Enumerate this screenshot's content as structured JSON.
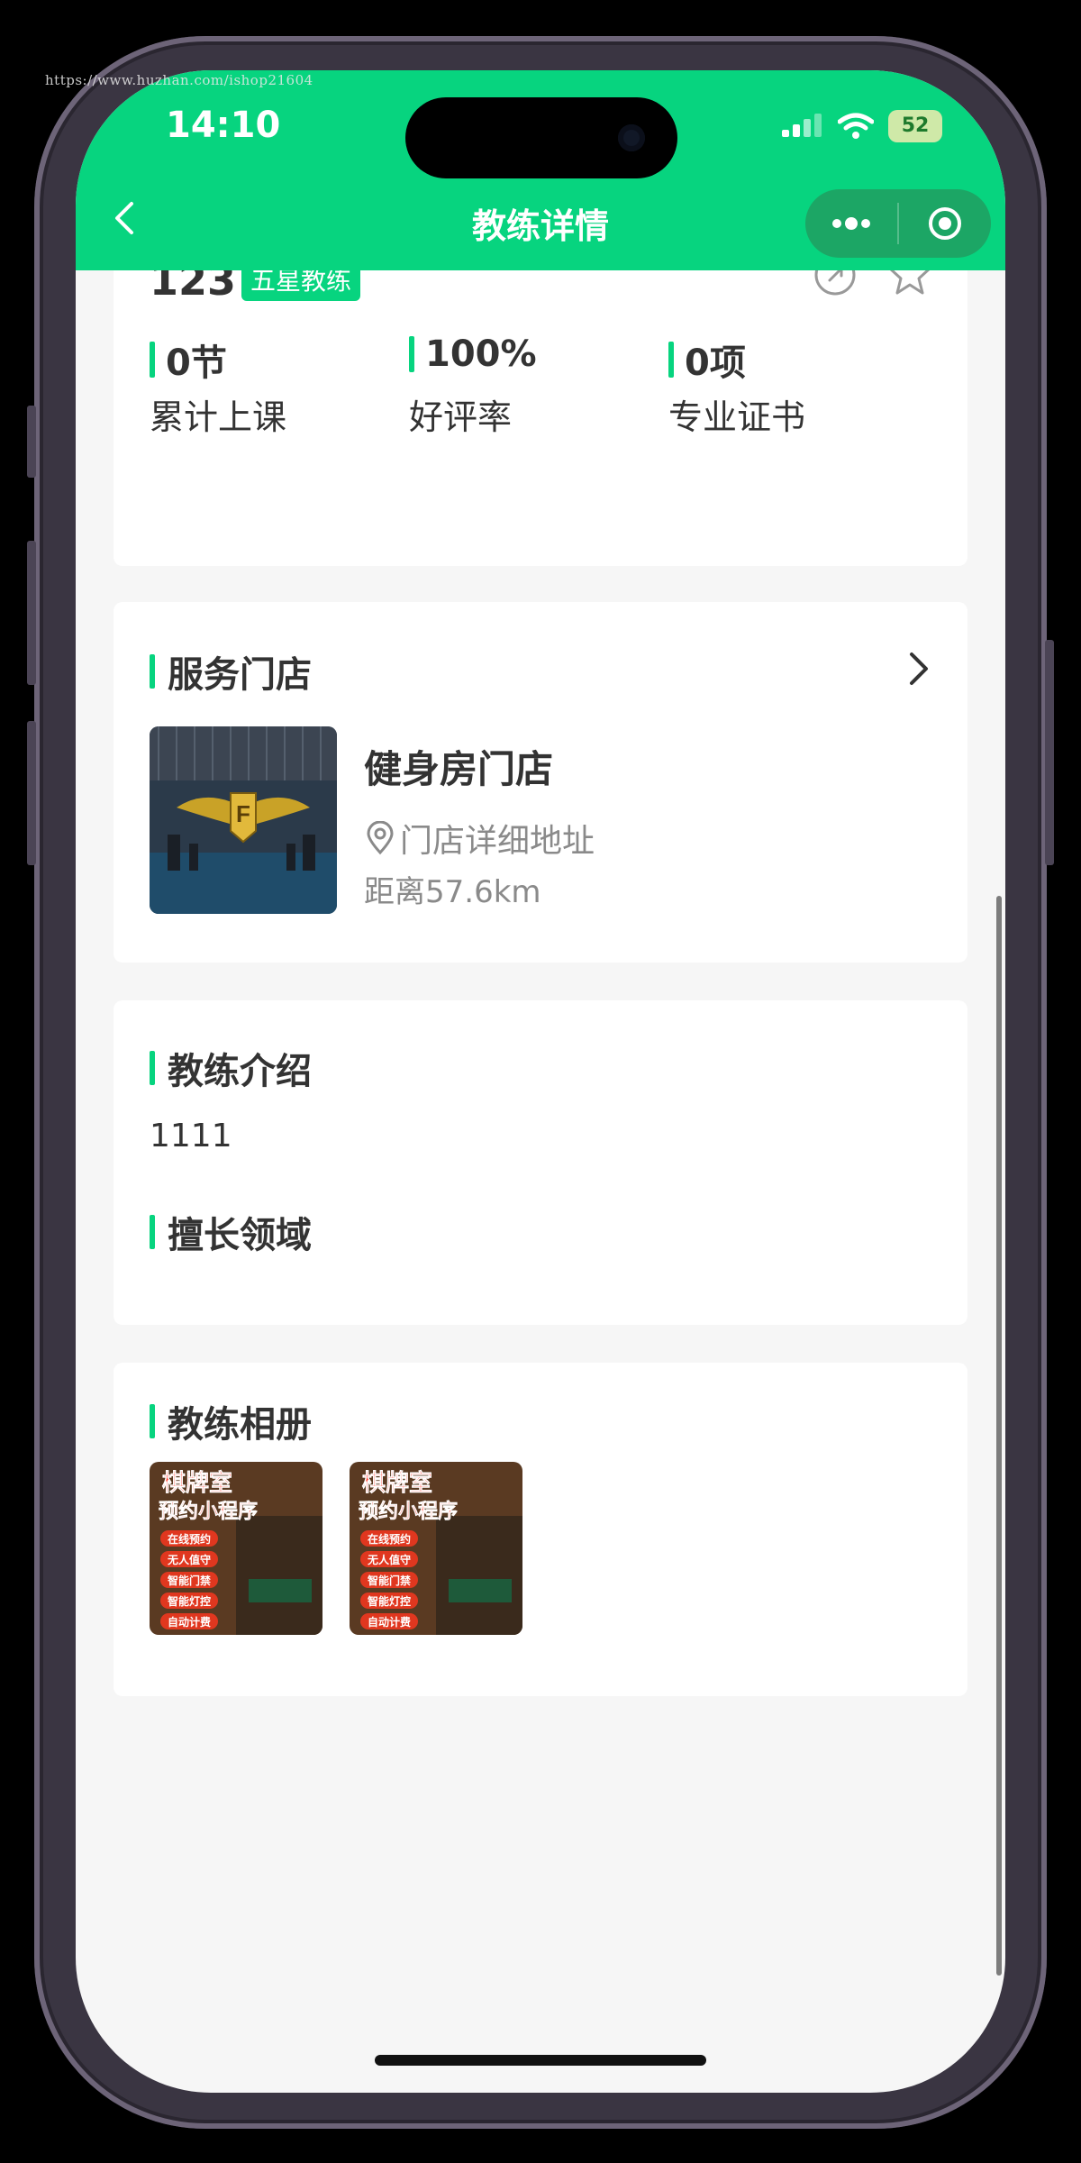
{
  "watermark": "https://www.huzhan.com/ishop21604",
  "status_bar": {
    "time": "14:10",
    "battery": "52"
  },
  "nav": {
    "title": "教练详情"
  },
  "coach": {
    "name_partial": "123",
    "level_badge": "五星教练",
    "stats": [
      {
        "value": "0节",
        "label": "累计上课"
      },
      {
        "value": "100%",
        "label": "好评率"
      },
      {
        "value": "0项",
        "label": "专业证书"
      }
    ]
  },
  "service_store": {
    "section_title": "服务门店",
    "name": "健身房门店",
    "address": "门店详细地址",
    "distance": "距离57.6km"
  },
  "intro": {
    "section_title": "教练介绍",
    "text": "1111",
    "specialty_title": "擅长领域"
  },
  "album": {
    "section_title": "教练相册",
    "photos": [
      {
        "heading1": "棋牌室",
        "heading2": "预约小程序",
        "tags": [
          "在线预约",
          "无人值守",
          "智能门禁",
          "智能灯控",
          "自动计费"
        ]
      },
      {
        "heading1": "棋牌室",
        "heading2": "预约小程序",
        "tags": [
          "在线预约",
          "无人值守",
          "智能门禁",
          "智能灯控",
          "自动计费"
        ]
      }
    ]
  },
  "colors": {
    "brand_green": "#07d47f",
    "capsule": "#1ca665",
    "background": "#f6f6f6"
  },
  "icons": [
    "back-icon",
    "share-icon",
    "star-icon",
    "chevron-right-icon",
    "location-pin-icon",
    "more-dots-icon",
    "target-icon"
  ]
}
